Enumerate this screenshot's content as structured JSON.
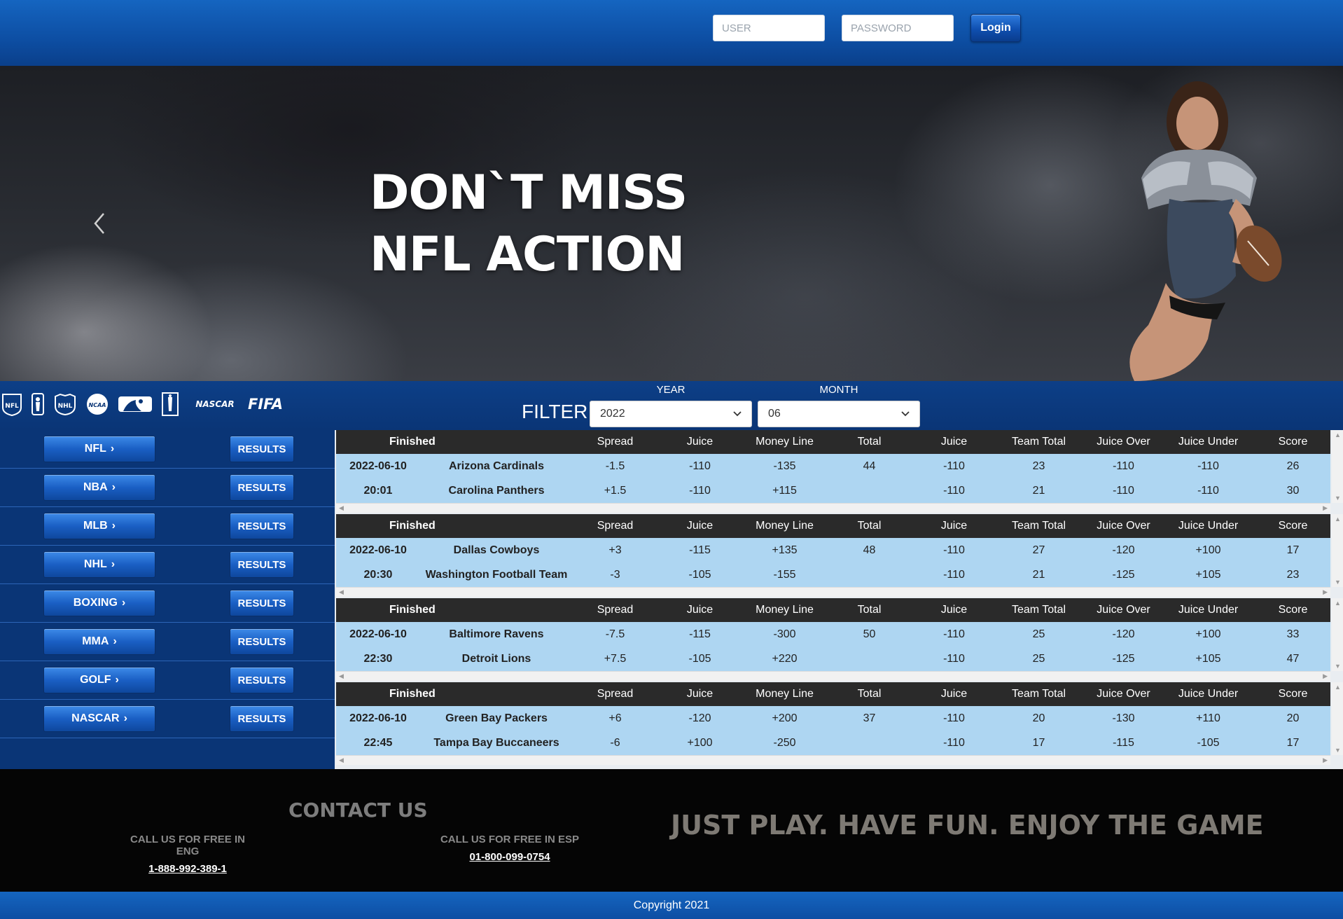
{
  "header": {
    "user_placeholder": "USER",
    "password_placeholder": "PASSWORD",
    "login_label": "Login"
  },
  "hero": {
    "title": "DON`T MISS\nNFL ACTION"
  },
  "leagues": [
    "nfl-logo",
    "nba-logo",
    "nhl-logo",
    "ncaa-logo",
    "mlb-logo",
    "pga-logo",
    "nascar-logo",
    "fifa-logo"
  ],
  "league_texts": {
    "ncaa": "NCAA",
    "nascar": "NASCAR",
    "fifa": "FIFA"
  },
  "filter": {
    "label": "FILTER",
    "year_label": "YEAR",
    "year_value": "2022",
    "month_label": "MONTH",
    "month_value": "06"
  },
  "sidebar": {
    "results_label": "RESULTS",
    "sports": [
      "NFL",
      "NBA",
      "MLB",
      "NHL",
      "BOXING",
      "MMA",
      "GOLF",
      "NASCAR"
    ]
  },
  "table_headers": [
    "Finished",
    "Spread",
    "Juice",
    "Money Line",
    "Total",
    "Juice",
    "Team Total",
    "Juice Over",
    "Juice Under",
    "Score"
  ],
  "games": [
    {
      "date": "2022-06-10",
      "time": "20:01",
      "rows": [
        {
          "team": "Arizona Cardinals",
          "spread": "-1.5",
          "juice": "-110",
          "money_line": "-135",
          "total": "44",
          "total_juice": "-110",
          "team_total": "23",
          "juice_over": "-110",
          "juice_under": "-110",
          "score": "26"
        },
        {
          "team": "Carolina Panthers",
          "spread": "+1.5",
          "juice": "-110",
          "money_line": "+115",
          "total": "",
          "total_juice": "-110",
          "team_total": "21",
          "juice_over": "-110",
          "juice_under": "-110",
          "score": "30"
        }
      ]
    },
    {
      "date": "2022-06-10",
      "time": "20:30",
      "rows": [
        {
          "team": "Dallas Cowboys",
          "spread": "+3",
          "juice": "-115",
          "money_line": "+135",
          "total": "48",
          "total_juice": "-110",
          "team_total": "27",
          "juice_over": "-120",
          "juice_under": "+100",
          "score": "17"
        },
        {
          "team": "Washington Football Team",
          "spread": "-3",
          "juice": "-105",
          "money_line": "-155",
          "total": "",
          "total_juice": "-110",
          "team_total": "21",
          "juice_over": "-125",
          "juice_under": "+105",
          "score": "23"
        }
      ]
    },
    {
      "date": "2022-06-10",
      "time": "22:30",
      "rows": [
        {
          "team": "Baltimore Ravens",
          "spread": "-7.5",
          "juice": "-115",
          "money_line": "-300",
          "total": "50",
          "total_juice": "-110",
          "team_total": "25",
          "juice_over": "-120",
          "juice_under": "+100",
          "score": "33"
        },
        {
          "team": "Detroit Lions",
          "spread": "+7.5",
          "juice": "-105",
          "money_line": "+220",
          "total": "",
          "total_juice": "-110",
          "team_total": "25",
          "juice_over": "-125",
          "juice_under": "+105",
          "score": "47"
        }
      ]
    },
    {
      "date": "2022-06-10",
      "time": "22:45",
      "rows": [
        {
          "team": "Green Bay Packers",
          "spread": "+6",
          "juice": "-120",
          "money_line": "+200",
          "total": "37",
          "total_juice": "-110",
          "team_total": "20",
          "juice_over": "-130",
          "juice_under": "+110",
          "score": "20"
        },
        {
          "team": "Tampa Bay Buccaneers",
          "spread": "-6",
          "juice": "+100",
          "money_line": "-250",
          "total": "",
          "total_juice": "-110",
          "team_total": "17",
          "juice_over": "-115",
          "juice_under": "-105",
          "score": "17"
        }
      ]
    }
  ],
  "footer": {
    "contact_title": "CONTACT US",
    "eng_label": "CALL US FOR FREE IN ENG",
    "eng_phone": "1-888-992-389-1",
    "esp_label": "CALL US FOR FREE IN ESP",
    "esp_phone": "01-800-099-0754",
    "tagline": "JUST PLAY. HAVE FUN. ENJOY THE GAME",
    "copyright": "Copyright 2021"
  },
  "colors": {
    "header_blue": "#1565c0",
    "sidebar_blue": "#0a3576",
    "row_light_blue": "#aed6f2",
    "table_header_dark": "#2a2a2a"
  }
}
